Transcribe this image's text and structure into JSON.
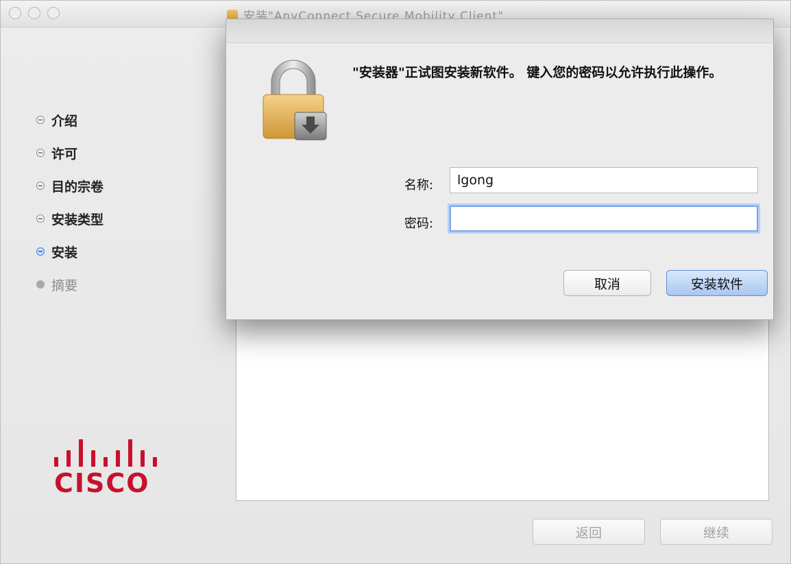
{
  "window": {
    "title": "安装\"AnyConnect Secure Mobility Client\""
  },
  "sidebar": {
    "steps": [
      {
        "label": "介绍",
        "state": "done"
      },
      {
        "label": "许可",
        "state": "done"
      },
      {
        "label": "目的宗卷",
        "state": "done"
      },
      {
        "label": "安装类型",
        "state": "done"
      },
      {
        "label": "安装",
        "state": "active"
      },
      {
        "label": "摘要",
        "state": "future"
      }
    ]
  },
  "logo": {
    "word": "CISCO",
    "color": "#c8102e"
  },
  "footer": {
    "back_label": "返回",
    "continue_label": "继续"
  },
  "auth_dialog": {
    "message": "\"安装器\"正试图安装新软件。 键入您的密码以允许执行此操作。",
    "name_label": "名称:",
    "name_value": "lgong",
    "password_label": "密码:",
    "password_value": "",
    "cancel_label": "取消",
    "install_label": "安装软件",
    "icon": "lock-icon",
    "accent_color": "#5f8ecf"
  }
}
